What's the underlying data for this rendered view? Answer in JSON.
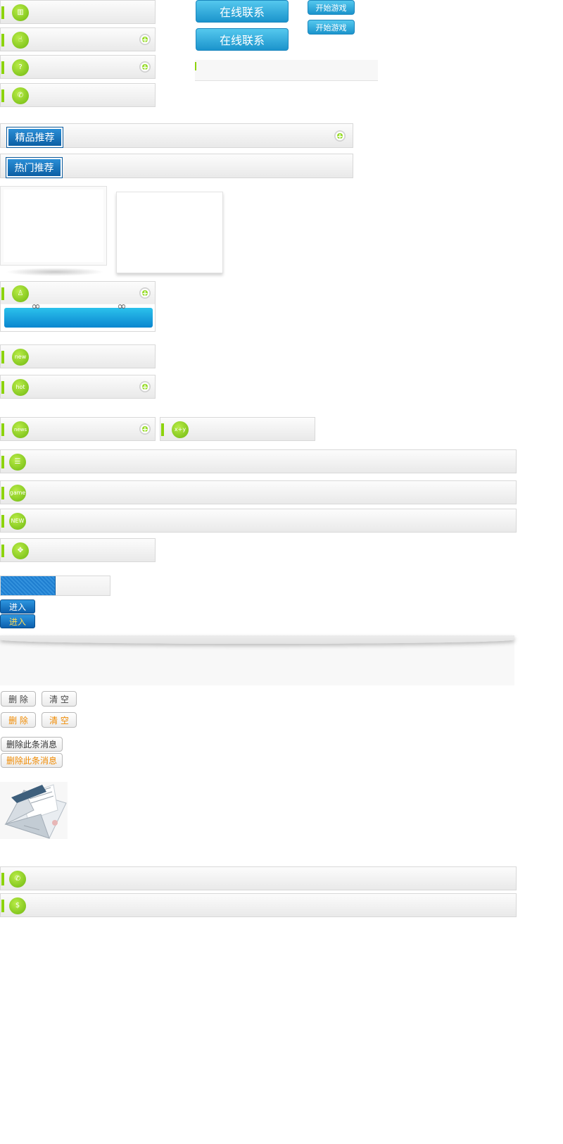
{
  "buttons": {
    "contact_online_1": "在线联系",
    "contact_online_2": "在线联系",
    "start_game_1": "开始游戏",
    "start_game_2": "开始游戏",
    "enter_1": "进入",
    "enter_2": "进入",
    "delete": "删 除",
    "clear": "清 空",
    "delete_hover": "删 除",
    "clear_hover": "清 空",
    "delete_message": "删除此条消息",
    "delete_message_hover": "删除此条消息"
  },
  "tabs": {
    "featured": "精品推荐",
    "hot": "热门推荐"
  },
  "icons": {
    "stats": "bar-chart-icon",
    "hand": "hand-pointer-icon",
    "question": "question-icon",
    "phone": "phone-icon",
    "person": "person-icon",
    "new": "new",
    "hot": "hot",
    "news": "news",
    "formula": "x+y",
    "list": "list-icon",
    "game": "game",
    "new_badge": "NEW",
    "apps": "apps-icon",
    "call": "phone-call-icon",
    "money": "$"
  },
  "colors": {
    "accent_green": "#8dd30d",
    "blue": "#1b94cc",
    "orange_text": "#f08a00"
  }
}
